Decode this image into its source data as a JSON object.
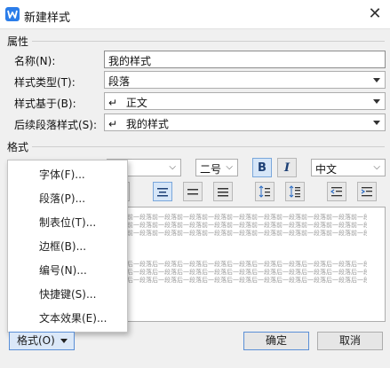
{
  "window": {
    "title": "新建样式",
    "close_glyph": "✕"
  },
  "attributes": {
    "section_label": "属性",
    "name_label": "名称(N):",
    "name_value": "我的样式",
    "type_label": "样式类型(T):",
    "type_value": "段落",
    "based_on_label": "样式基于(B):",
    "based_on_value": "正文",
    "following_label": "后续段落样式(S):",
    "following_value": "我的样式",
    "para_mark": "↵"
  },
  "format": {
    "section_label": "格式",
    "font_size_value": "二号",
    "bold_label": "B",
    "italic_label": "I",
    "language_value": "中文"
  },
  "preview": {
    "top_text": "前一段落前一段落前一段落前一段落前一段落前一段落前一段落前一段落前一段落前一段落前一段落前一段落",
    "bottom_text": "后一段落后一段落后一段落后一段落后一段落后一段落后一段落后一段落后一段落后一段落后一段落后一段落"
  },
  "format_menu": {
    "items": [
      "字体(F)...",
      "段落(P)...",
      "制表位(T)...",
      "边框(B)...",
      "编号(N)...",
      "快捷键(S)...",
      "文本效果(E)..."
    ]
  },
  "buttons": {
    "format_label": "格式(O)",
    "ok_label": "确定",
    "cancel_label": "取消"
  },
  "colors": {
    "accent": "#2b7de9",
    "active_button": "#d6e6f8"
  }
}
